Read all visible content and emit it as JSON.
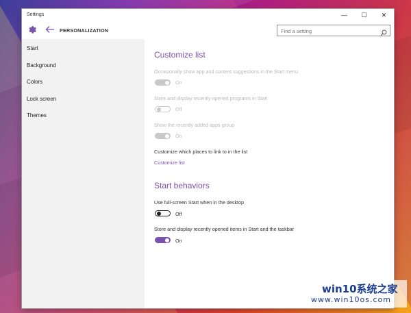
{
  "window": {
    "title": "Settings",
    "controls": {
      "minimize": "—",
      "maximize": "☐",
      "close": "✕"
    }
  },
  "header": {
    "icon": "gear-icon",
    "back_icon": "back-arrow-icon",
    "section": "PERSONALIZATION",
    "search_placeholder": "Find a setting",
    "search_value": ""
  },
  "sidebar": {
    "items": [
      {
        "label": "Start"
      },
      {
        "label": "Background"
      },
      {
        "label": "Colors"
      },
      {
        "label": "Lock screen"
      },
      {
        "label": "Themes"
      }
    ]
  },
  "customize_list": {
    "heading": "Customize list",
    "settings": [
      {
        "label": "Occasionally show app and content suggestions in the Start menu",
        "state": "On",
        "enabled": false
      },
      {
        "label": "Store and display recently opened programs in Start",
        "state": "Off",
        "enabled": false
      },
      {
        "label": "Show the recently added apps group",
        "state": "On",
        "enabled": false
      }
    ],
    "places_label": "Customize which places to link to in the list",
    "link": "Customize list"
  },
  "start_behaviors": {
    "heading": "Start behaviors",
    "settings": [
      {
        "label": "Use full-screen Start when in the desktop",
        "state": "Off",
        "enabled": true
      },
      {
        "label": "Store and display recently opened items in Start and the taskbar",
        "state": "On",
        "enabled": true
      }
    ]
  },
  "watermark": {
    "line1": "win10系统之家",
    "line2": "www.win10os.com"
  },
  "colors": {
    "accent": "#7b52ab",
    "sidebar_bg": "#f2f2f2",
    "disabled_text": "#b8b8b8"
  }
}
